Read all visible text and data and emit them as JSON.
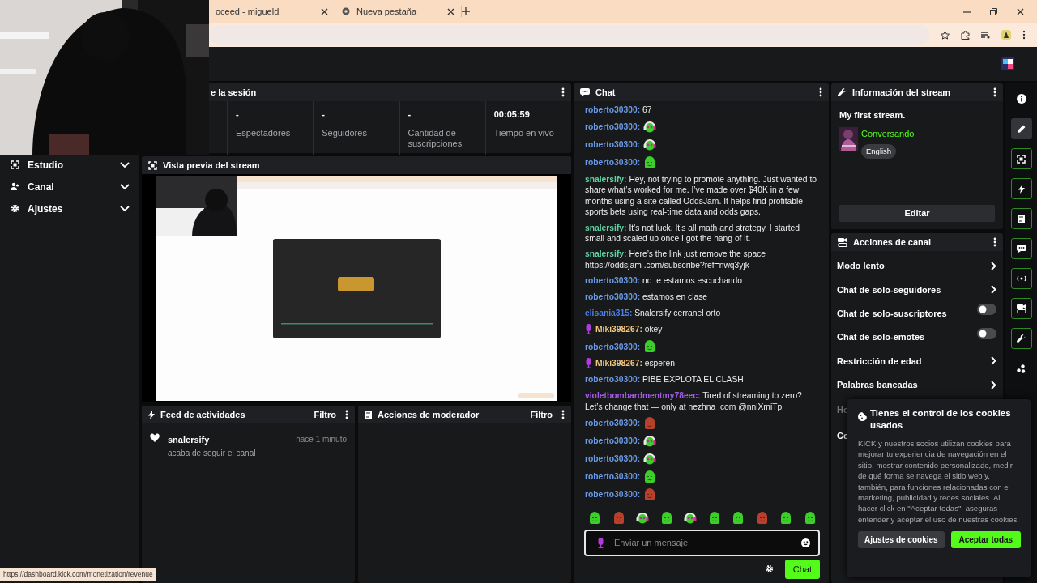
{
  "browser": {
    "tabs": [
      {
        "title": "oceed - migueld"
      },
      {
        "title": "Nueva pestaña"
      }
    ]
  },
  "sidebar": {
    "items": [
      {
        "label": "Estudio"
      },
      {
        "label": "Canal"
      },
      {
        "label": "Ajustes"
      }
    ]
  },
  "session": {
    "title": "e la sesión",
    "stats": [
      {
        "value": "-",
        "label": "Espectadores"
      },
      {
        "value": "-",
        "label": "Seguidores"
      },
      {
        "value": "-",
        "label": "Cantidad de suscripciones"
      },
      {
        "value": "00:05:59",
        "label": "Tiempo en vivo"
      }
    ]
  },
  "preview": {
    "title": "Vista previa del stream"
  },
  "activity_feed": {
    "title": "Feed de actividades",
    "filter": "Filtro",
    "items": [
      {
        "user": "snalersify",
        "time": "hace 1 minuto",
        "action": "acaba de seguir el canal"
      }
    ]
  },
  "moderator_actions": {
    "title": "Acciones de moderador",
    "filter": "Filtro"
  },
  "chat": {
    "title": "Chat",
    "messages": [
      {
        "kind": "text",
        "user": "roberto30300:",
        "color": "#6b9be8",
        "badge": false,
        "text": "67"
      },
      {
        "kind": "emote",
        "user": "roberto30300:",
        "color": "#6b9be8",
        "badge": false,
        "emote": {
          "color": "#3ccf2a",
          "headphones": true
        }
      },
      {
        "kind": "emote",
        "user": "roberto30300:",
        "color": "#6b9be8",
        "badge": false,
        "emote": {
          "color": "#3ccf2a",
          "headphones": true
        }
      },
      {
        "kind": "emote",
        "user": "roberto30300:",
        "color": "#6b9be8",
        "badge": false,
        "emote": {
          "color": "#3ccf2a",
          "headphones": false
        }
      },
      {
        "kind": "text",
        "user": "snalersify:",
        "color": "#5fd4a2",
        "badge": false,
        "text": "Hey, not trying to promote anything. Just wanted to share what’s worked for me. I’ve made over $40K in a few months using a site called OddsJam. It helps find profitable sports bets using real-time data and odds gaps."
      },
      {
        "kind": "text",
        "user": "snalersify:",
        "color": "#5fd4a2",
        "badge": false,
        "text": "It’s not luck. It’s all math and strategy. I started small and scaled up once I got the hang of it."
      },
      {
        "kind": "text",
        "user": "snalersify:",
        "color": "#5fd4a2",
        "badge": false,
        "text": "Here’s the link just remove the space https://oddsjam .com/subscribe?ref=nwq3yjk"
      },
      {
        "kind": "text",
        "user": "roberto30300:",
        "color": "#6b9be8",
        "badge": false,
        "text": "no te estamos escuchando"
      },
      {
        "kind": "text",
        "user": "roberto30300:",
        "color": "#6b9be8",
        "badge": false,
        "text": "estamos en clase"
      },
      {
        "kind": "text",
        "user": "elisania315:",
        "color": "#4f7fe8",
        "badge": false,
        "text": "Snalersify cerranel orto"
      },
      {
        "kind": "text",
        "user": "Miki398267:",
        "color": "#f3c77d",
        "badge": true,
        "text": "okey"
      },
      {
        "kind": "emote",
        "user": "roberto30300:",
        "color": "#6b9be8",
        "badge": false,
        "emote": {
          "color": "#3ccf2a",
          "headphones": false
        }
      },
      {
        "kind": "text",
        "user": "Miki398267:",
        "color": "#f3c77d",
        "badge": true,
        "text": "esperen"
      },
      {
        "kind": "text",
        "user": "roberto30300:",
        "color": "#6b9be8",
        "badge": false,
        "text": "PIBE EXPLOTA EL CLASH"
      },
      {
        "kind": "text",
        "user": "violetbombardmentmy78eec:",
        "color": "#a55ce8",
        "badge": false,
        "text": "Tired of streaming to zero? Let’s change that — only at nezhna .com @nnlXmiTp"
      },
      {
        "kind": "emote",
        "user": "roberto30300:",
        "color": "#6b9be8",
        "badge": false,
        "emote": {
          "color": "#b9402b",
          "headphones": false
        }
      },
      {
        "kind": "emote",
        "user": "roberto30300:",
        "color": "#6b9be8",
        "badge": false,
        "emote": {
          "color": "#3ccf2a",
          "headphones": true
        }
      },
      {
        "kind": "emote",
        "user": "roberto30300:",
        "color": "#6b9be8",
        "badge": false,
        "emote": {
          "color": "#3ccf2a",
          "headphones": true
        }
      },
      {
        "kind": "emote",
        "user": "roberto30300:",
        "color": "#6b9be8",
        "badge": false,
        "emote": {
          "color": "#3ccf2a",
          "headphones": false
        }
      },
      {
        "kind": "emote",
        "user": "roberto30300:",
        "color": "#6b9be8",
        "badge": false,
        "emote": {
          "color": "#b9402b",
          "headphones": false
        }
      }
    ],
    "input": {
      "placeholder": "Enviar un mensaje"
    },
    "send": "Chat"
  },
  "stream_info": {
    "title": "Información del stream",
    "stream_title": "My first stream.",
    "category": "Conversando",
    "tags": [
      "English"
    ],
    "edit": "Editar"
  },
  "channel_actions": {
    "title": "Acciones de canal",
    "items": [
      {
        "label": "Modo lento",
        "kind": "link",
        "disabled": false
      },
      {
        "label": "Chat de solo-seguidores",
        "kind": "link",
        "disabled": false
      },
      {
        "label": "Chat de solo-suscriptores",
        "kind": "toggle",
        "on": false,
        "disabled": false
      },
      {
        "label": "Chat de solo-emotes",
        "kind": "toggle",
        "on": false,
        "disabled": false
      },
      {
        "label": "Restricción de edad",
        "kind": "link",
        "disabled": false
      },
      {
        "label": "Palabras baneadas",
        "kind": "link",
        "disabled": false
      },
      {
        "label": "Ho",
        "kind": "partial",
        "disabled": true
      },
      {
        "label": "Co",
        "kind": "partial",
        "disabled": false
      }
    ]
  },
  "panel_toggles": [
    {
      "on": false,
      "selected": false
    },
    {
      "on": false,
      "selected": true
    },
    {
      "on": true,
      "selected": false
    },
    {
      "on": true,
      "selected": false
    },
    {
      "on": true,
      "selected": false
    },
    {
      "on": true,
      "selected": false
    },
    {
      "on": true,
      "selected": false
    },
    {
      "on": true,
      "selected": false
    },
    {
      "on": true,
      "selected": false
    },
    {
      "on": false,
      "selected": false
    }
  ],
  "cookie_banner": {
    "title": "Tienes el control de los cookies usados",
    "body": "KICK y nuestros socios utilizan cookies para mejorar tu experiencia de navegación en el sitio, mostrar contenido personalizado, medir de qué forma se navega el sitio web y, también, para funciones relacionadas con el marketing, publicidad y redes sociales. Al hacer click en \"Aceptar todas\", aseguras entender y aceptar el uso de nuestras cookies.",
    "buttons": [
      {
        "label": "Ajustes de cookies",
        "kind": "secondary"
      },
      {
        "label": "Aceptar todas",
        "kind": "primary"
      }
    ]
  },
  "status_url": "https://dashboard.kick.com/monetization/revenue"
}
